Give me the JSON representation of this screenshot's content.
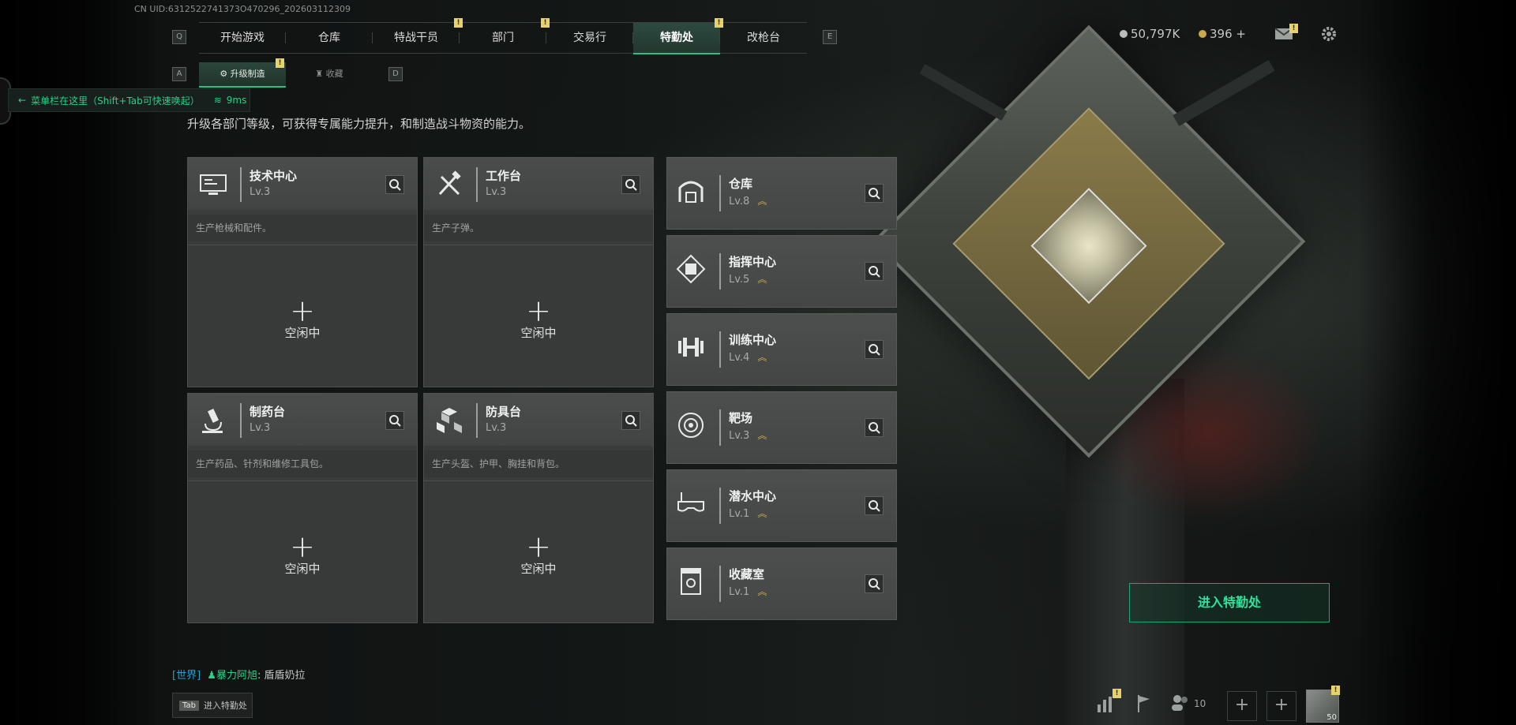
{
  "uid": "CN UID:6312522741373O470296_202603112309",
  "keys": {
    "q": "Q",
    "e": "E",
    "a": "A",
    "d": "D"
  },
  "nav_tabs": [
    {
      "label": "开始游戏",
      "badge": ""
    },
    {
      "label": "仓库",
      "badge": ""
    },
    {
      "label": "特战干员",
      "badge": "!"
    },
    {
      "label": "部门",
      "badge": "!"
    },
    {
      "label": "交易行",
      "badge": ""
    },
    {
      "label": "特勤处",
      "badge": "!"
    },
    {
      "label": "改枪台",
      "badge": ""
    }
  ],
  "active_tab": "特勤处",
  "sub_tabs": [
    {
      "label": "升级制造",
      "badge": "!"
    },
    {
      "label": "收藏",
      "badge": ""
    }
  ],
  "toast": {
    "text": "菜单栏在这里（Shift+Tab可快速唤起）",
    "ping": "9ms"
  },
  "description": "升级各部门等级，可获得专属能力提升，和制造战斗物资的能力。",
  "craft_cards": [
    {
      "title": "技术中心",
      "level": "Lv.3",
      "subtitle": "生产枪械和配件。",
      "status": "空闲中",
      "icon": "monitor-icon"
    },
    {
      "title": "工作台",
      "level": "Lv.3",
      "subtitle": "生产子弹。",
      "status": "空闲中",
      "icon": "tools-icon"
    },
    {
      "title": "制药台",
      "level": "Lv.3",
      "subtitle": "生产药品、针剂和维修工具包。",
      "status": "空闲中",
      "icon": "microscope-icon"
    },
    {
      "title": "防具台",
      "level": "Lv.3",
      "subtitle": "生产头盔、护甲、胸挂和背包。",
      "status": "空闲中",
      "icon": "armor-boxes-icon"
    }
  ],
  "dept_cards": [
    {
      "title": "仓库",
      "level": "Lv.8",
      "icon": "warehouse-icon"
    },
    {
      "title": "指挥中心",
      "level": "Lv.5",
      "icon": "chip-icon"
    },
    {
      "title": "训练中心",
      "level": "Lv.4",
      "icon": "dumbbell-icon"
    },
    {
      "title": "靶场",
      "level": "Lv.3",
      "icon": "target-icon"
    },
    {
      "title": "潜水中心",
      "level": "Lv.1",
      "icon": "diving-mask-icon"
    },
    {
      "title": "收藏室",
      "level": "Lv.1",
      "icon": "trophy-case-icon"
    }
  ],
  "enter_button": "进入特勤处",
  "currency": {
    "money": "50,797K",
    "coins": "396 +"
  },
  "mail_badge": "!",
  "chat": {
    "channel": "[世界]",
    "user": "暴力阿旭",
    "message": ": 盾盾奶拉"
  },
  "tab_hint": {
    "key": "Tab",
    "label": "进入特勤处"
  },
  "bottom": {
    "chart_badge": "!",
    "friends_count": "10",
    "avatar_level": "50",
    "avatar_badge": "!"
  },
  "colors": {
    "accent": "#26c18a",
    "badge": "#e8d26a",
    "upgrade": "#c9a84f"
  }
}
